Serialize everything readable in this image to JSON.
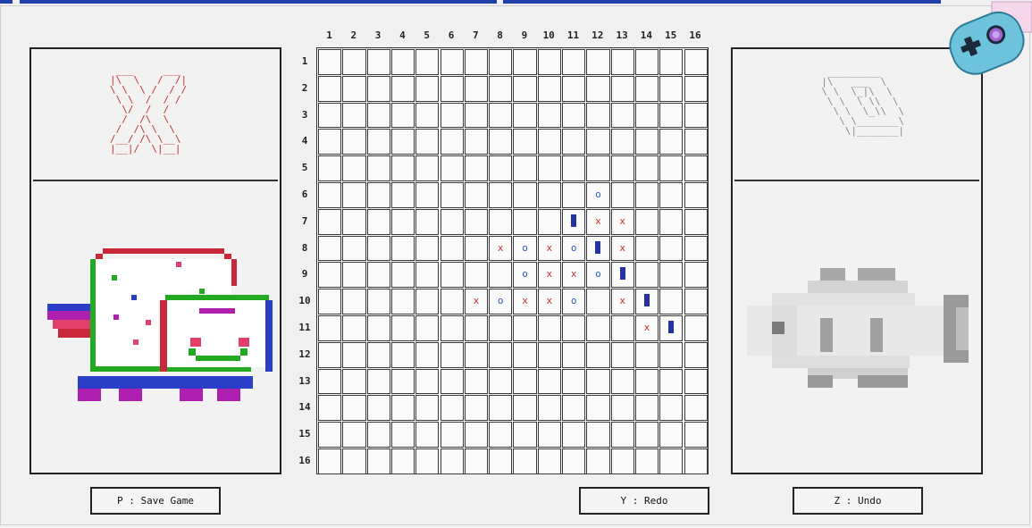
{
  "colors": {
    "x_mark": "#c23030",
    "o_mark": "#2858b8",
    "cursor": "#2433a0",
    "accent_bar": "#1e3ea8",
    "grid_line": "#3a3a3a"
  },
  "player_x": {
    "symbol": "X",
    "ascii_art": " ___     ___\n|\\  \\   /  /|\n\\ \\  \\ /  / /\n \\ \\  /  / /\n  \\/  /  /\n  /  /\\  \\\n /  /\\ \\  \\\n/__/ /\\ \\__\\\n|__|/  \\|__|",
    "avatar": "pixel-cat"
  },
  "player_o": {
    "symbol": "O",
    "ascii_art": "   _________\n  |\\   ___  \\\n  \\ \\  \\_|\\  \\\n   \\ \\  \\ \\\\  \\\n    \\ \\  \\_\\\\  \\\n     \\ \\_______\\\n      \\|_______|",
    "avatar": "pixel-fish"
  },
  "board": {
    "col_labels": [
      "1",
      "2",
      "3",
      "4",
      "5",
      "6",
      "7",
      "8",
      "9",
      "10",
      "11",
      "12",
      "13",
      "14",
      "15",
      "16"
    ],
    "row_labels": [
      "1",
      "2",
      "3",
      "4",
      "5",
      "6",
      "7",
      "8",
      "9",
      "10",
      "11",
      "12",
      "13",
      "14",
      "15",
      "16"
    ],
    "marks": [
      {
        "row": 6,
        "col": 12,
        "mark": "O"
      },
      {
        "row": 7,
        "col": 11,
        "mark": "cursor"
      },
      {
        "row": 7,
        "col": 12,
        "mark": "X"
      },
      {
        "row": 7,
        "col": 13,
        "mark": "X"
      },
      {
        "row": 8,
        "col": 8,
        "mark": "X"
      },
      {
        "row": 8,
        "col": 9,
        "mark": "O"
      },
      {
        "row": 8,
        "col": 10,
        "mark": "X"
      },
      {
        "row": 8,
        "col": 11,
        "mark": "O"
      },
      {
        "row": 8,
        "col": 12,
        "mark": "cursor"
      },
      {
        "row": 8,
        "col": 13,
        "mark": "X"
      },
      {
        "row": 9,
        "col": 9,
        "mark": "O"
      },
      {
        "row": 9,
        "col": 10,
        "mark": "X"
      },
      {
        "row": 9,
        "col": 11,
        "mark": "X"
      },
      {
        "row": 9,
        "col": 12,
        "mark": "O"
      },
      {
        "row": 9,
        "col": 13,
        "mark": "cursor"
      },
      {
        "row": 10,
        "col": 7,
        "mark": "X"
      },
      {
        "row": 10,
        "col": 8,
        "mark": "O"
      },
      {
        "row": 10,
        "col": 9,
        "mark": "X"
      },
      {
        "row": 10,
        "col": 10,
        "mark": "X"
      },
      {
        "row": 10,
        "col": 11,
        "mark": "O"
      },
      {
        "row": 10,
        "col": 13,
        "mark": "X"
      },
      {
        "row": 10,
        "col": 14,
        "mark": "cursor"
      },
      {
        "row": 11,
        "col": 14,
        "mark": "X"
      },
      {
        "row": 11,
        "col": 15,
        "mark": "cursor"
      }
    ]
  },
  "controls": {
    "save_label": "P : Save Game",
    "redo_label": "Y : Redo",
    "undo_label": "Z : Undo"
  },
  "logo_icon": "gamepad-icon"
}
